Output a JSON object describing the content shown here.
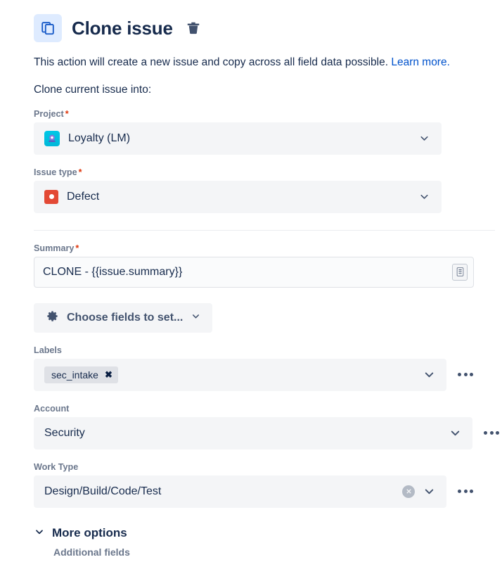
{
  "header": {
    "icon_name": "clone-issue-icon",
    "title": "Clone issue",
    "delete_icon": "trash-icon",
    "accent": "#0052CC",
    "icon_bg": "#DEEBFF"
  },
  "description": {
    "text": "This action will create a new issue and copy across all field data possible. ",
    "link_label": "Learn more.",
    "link_color": "#0052CC"
  },
  "subheading": "Clone current issue into:",
  "fields": {
    "project": {
      "label": "Project",
      "required": "*",
      "value": "Loyalty (LM)",
      "avatar_name": "project-avatar-loyalty"
    },
    "issue_type": {
      "label": "Issue type",
      "required": "*",
      "value": "Defect",
      "icon_name": "defect-type-icon",
      "icon_color": "#E34935"
    },
    "summary": {
      "label": "Summary",
      "required": "*",
      "value": "CLONE - {{issue.summary}}",
      "placeholder": "Summary",
      "token_icon": "smart-values-icon"
    },
    "labels": {
      "label": "Labels",
      "chips": [
        "sec_intake"
      ],
      "remove_glyph": "✖"
    },
    "account": {
      "label": "Account",
      "value": "Security"
    },
    "work_type": {
      "label": "Work Type",
      "value": "Design/Build/Code/Test",
      "clear_icon": "clear-value-icon"
    }
  },
  "choose_fields_button": {
    "label": "Choose fields to set...",
    "icon_name": "gear-icon"
  },
  "more_options": {
    "label": "More options",
    "chevron": "chevron-down-icon",
    "additional_fields_label": "Additional fields"
  },
  "overflow_menu_label": "more-actions"
}
